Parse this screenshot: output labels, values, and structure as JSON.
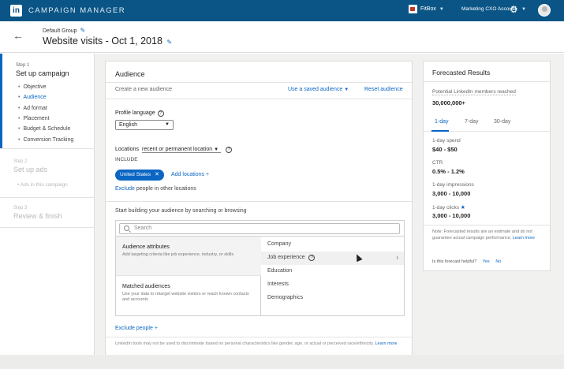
{
  "topbar": {
    "logo": "in",
    "brand": "CAMPAIGN MANAGER",
    "account_short": "FitBox",
    "account_name": "Marketing CXO Account"
  },
  "header": {
    "group_label": "Default Group",
    "title": "Website visits - Oct 1, 2018"
  },
  "sidebar": {
    "step1_small": "Step 1",
    "step1_title": "Set up campaign",
    "substeps": [
      "Objective",
      "Audience",
      "Ad format",
      "Placement",
      "Budget & Schedule",
      "Conversion Tracking"
    ],
    "active_substep": "Audience",
    "step2_small": "Step 2",
    "step2_title": "Set up ads",
    "step2_item": "Ads in this campaign",
    "step3_small": "Step 3",
    "step3_title": "Review & finish"
  },
  "audience": {
    "title": "Audience",
    "subtitle": "Create a new audience",
    "saved_audience": "Use a saved audience",
    "reset_audience": "Reset audience",
    "profile_language_label": "Profile language",
    "profile_language_value": "English",
    "locations_label": "Locations",
    "locations_type": "recent or permanent location",
    "include_label": "INCLUDE",
    "location_chip": "United States",
    "add_locations": "Add locations",
    "exclude_locations_link": "Exclude",
    "exclude_locations_rest": "people in other locations",
    "build_prompt": "Start building your audience by searching or browsing",
    "search_placeholder": "Search",
    "categories": [
      {
        "title": "Audience attributes",
        "desc": "Add targeting criteria like job experience, industry, or skills"
      },
      {
        "title": "Matched audiences",
        "desc": "Use your data to retarget website visitors or reach known contacts and accounts"
      }
    ],
    "options": [
      "Company",
      "Job experience",
      "Education",
      "Interests",
      "Demographics"
    ],
    "exclude_people": "Exclude people",
    "disclaimer": "LinkedIn tools may not be used to discriminate based on personal characteristics like gender, age, or actual or perceived race/ethnicity.",
    "learn_more": "Learn more"
  },
  "forecast": {
    "title": "Forecasted Results",
    "reach_label": "Potential LinkedIn members reached",
    "reach_value": "30,000,000+",
    "tabs": [
      "1-day",
      "7-day",
      "30-day"
    ],
    "active_tab": "1-day",
    "metrics": [
      {
        "label": "1-day spend",
        "value": "$40 - $50"
      },
      {
        "label": "CTR",
        "value": "0.5% - 1.2%"
      },
      {
        "label": "1-day impressions",
        "value": "3,000 - 10,000"
      },
      {
        "label": "1-day clicks",
        "value": "3,000 - 10,000"
      }
    ],
    "note": "Note: Forecasted results are an estimate and do not guarantee actual campaign performance.",
    "note_link": "Learn more",
    "helpful_q": "Is this forecast helpful?",
    "yes": "Yes",
    "no": "No"
  },
  "colors": {
    "topbar": "#0a5586",
    "accent": "#0a66c2",
    "background": "#f1f1ef"
  }
}
